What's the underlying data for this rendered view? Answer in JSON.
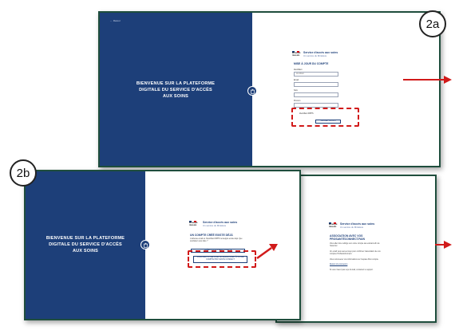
{
  "colors": {
    "brand_blue": "#1d3f79",
    "frame_green": "#1f4e3d",
    "highlight_red": "#d11a1a"
  },
  "screen_2a": {
    "badge": "2a",
    "back_link": "← Retour",
    "welcome": [
      "BIENVENUE SUR LA PLATEFORME",
      "DIGITALE DU SERVICE D'ACCÈS",
      "AUX SOINS"
    ],
    "republic_logo": [
      "RÉPUBLIQUE",
      "FRANÇAISE"
    ],
    "service_title": "Service d'accès aux soins",
    "service_subtitle": "Un service du Ministère",
    "form_title": "MISE À JOUR DU COMPTE",
    "fields": [
      {
        "label": "Identifiant",
        "value": "identifiant"
      },
      {
        "label": "Email",
        "value": ""
      },
      {
        "label": "Nom",
        "value": ""
      },
      {
        "label": "Prénom",
        "value": ""
      }
    ],
    "extra_label": "Identifiant RPPS",
    "submit_label": "VALIDER L'ENVOI"
  },
  "screen_2b": {
    "badge": "2b",
    "welcome": [
      "BIENVENUE SUR LA PLATEFORME",
      "DIGITALE DU SERVICE D'ACCÈS",
      "AUX SOINS"
    ],
    "republic_logo": [
      "RÉPUBLIQUE",
      "FRANÇAISE"
    ],
    "service_title": "Service d'accès aux soins",
    "service_subtitle": "Un service du Ministère",
    "heading": "UN COMPTE CRÉÉ EXISTE DÉJÀ",
    "paragraph": "L'adresse email ou l'identifiant RPPS renseigné existe déjà. Que souhaitez-vous faire ?",
    "option_1": "CRÉER UN NOUVEAU COMPTE",
    "option_2": "ASSOCIER VOTRE COMPTE SAS EXISTANT À VOTRE COMPTE PRO SANTÉ CONNECT"
  },
  "screen_2c": {
    "republic_logo": [
      "RÉPUBLIQUE",
      "FRANÇAISE"
    ],
    "service_title": "Service d'accès aux soins",
    "service_subtitle": "Un service du Ministère",
    "heading": "ASSOCIATION AVEC VOS PROSANTÉCONNECT.FAIN",
    "paragraphs": [
      "Vous allez être redirigé vers votre compte sas existant afin de l'associer.",
      "Un email vous sera envoyé pour confirmer l'association de vos comptes ProSantéConnect.",
      "Vous retrouverez vos informations sur l'espace Mon compte."
    ],
    "link_text": "Retour à la connexion",
    "footer": "Si vous n'avez pas reçu d'email, contactez le support."
  }
}
